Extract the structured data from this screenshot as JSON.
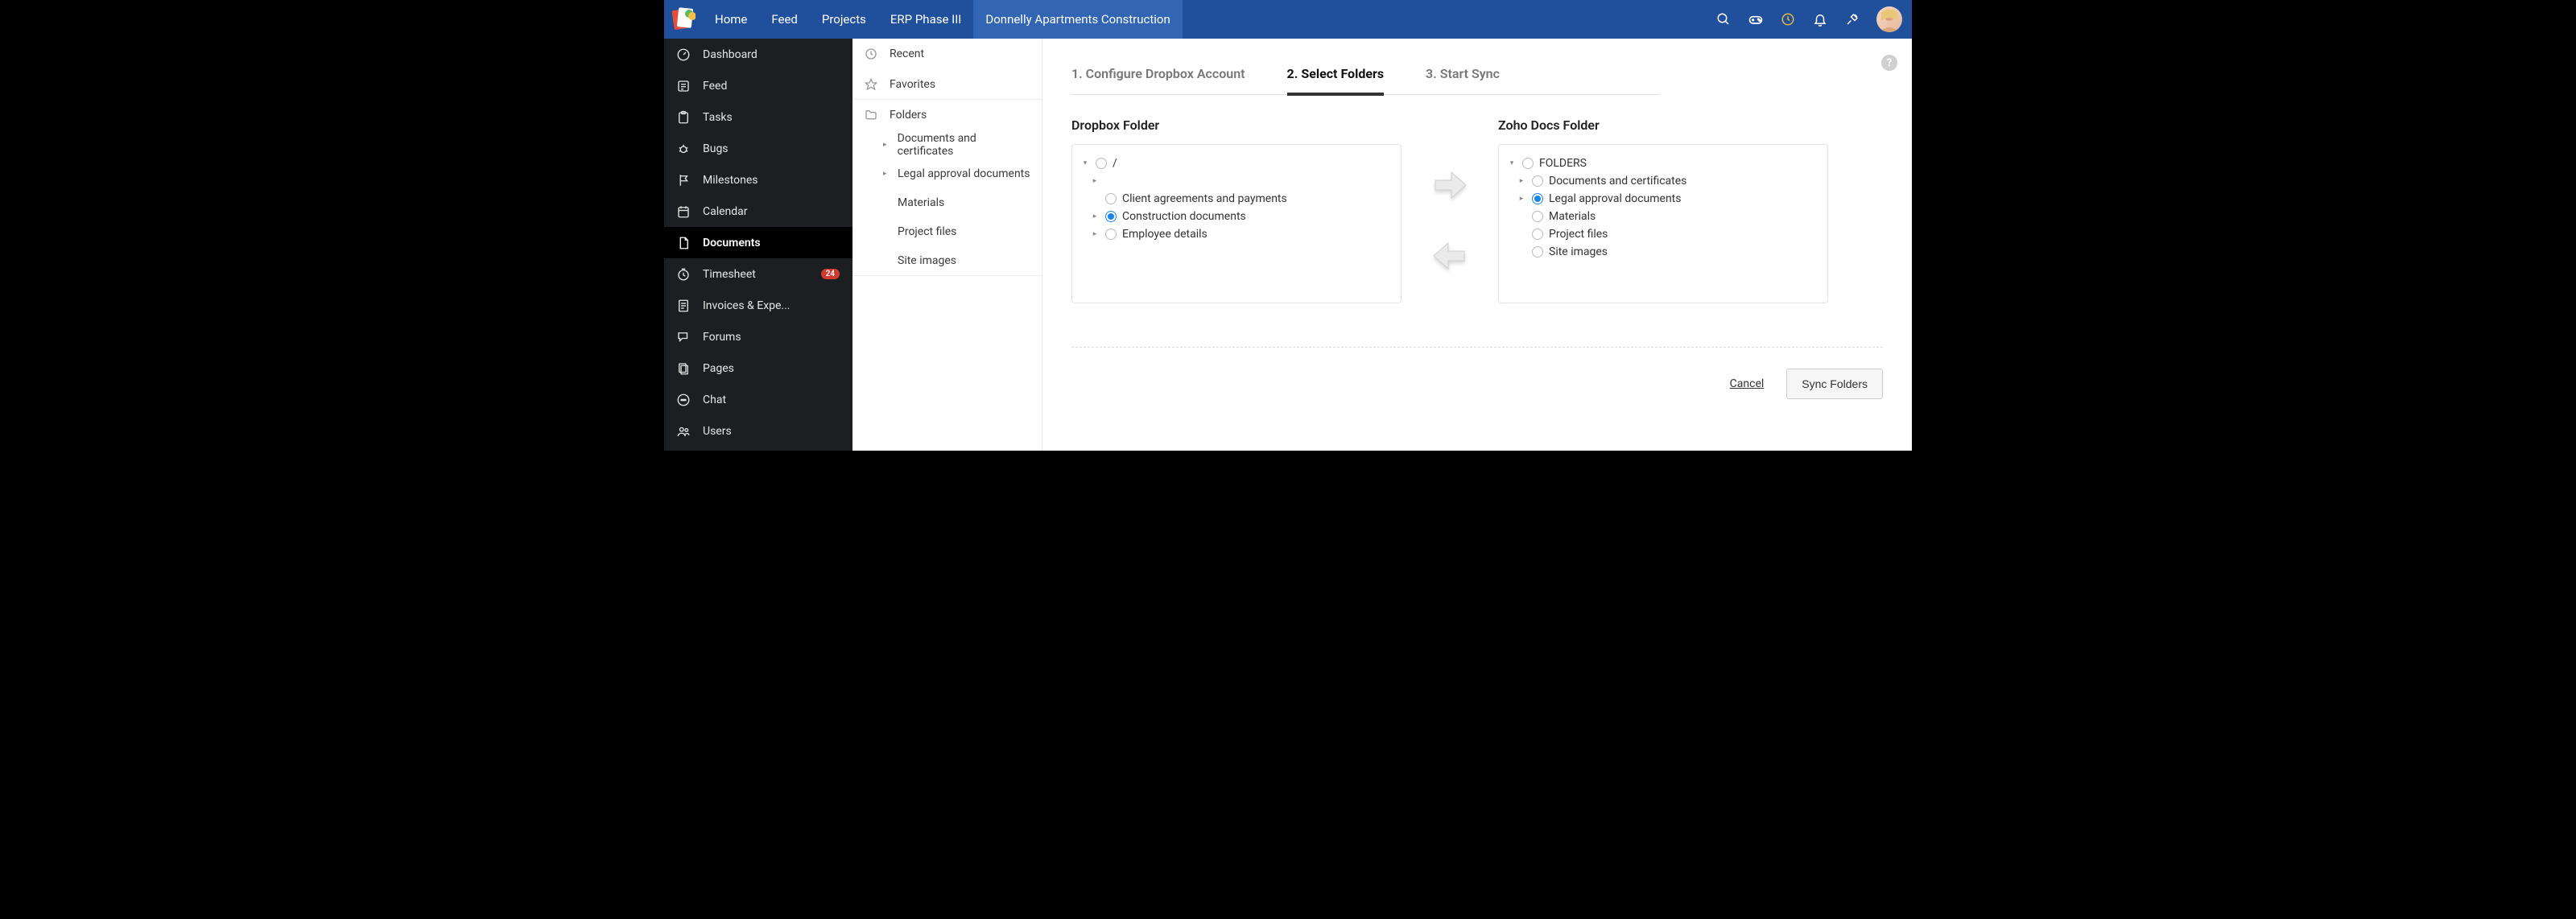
{
  "topnav": {
    "items": [
      {
        "label": "Home",
        "active": false
      },
      {
        "label": "Feed",
        "active": false
      },
      {
        "label": "Projects",
        "active": false
      },
      {
        "label": "ERP Phase III",
        "active": false
      },
      {
        "label": "Donnelly Apartments Construction",
        "active": true
      }
    ]
  },
  "sidebar": {
    "items": [
      {
        "icon": "dashboard",
        "label": "Dashboard"
      },
      {
        "icon": "feed",
        "label": "Feed"
      },
      {
        "icon": "tasks",
        "label": "Tasks"
      },
      {
        "icon": "bugs",
        "label": "Bugs"
      },
      {
        "icon": "milestones",
        "label": "Milestones"
      },
      {
        "icon": "calendar",
        "label": "Calendar"
      },
      {
        "icon": "documents",
        "label": "Documents",
        "active": true
      },
      {
        "icon": "timesheet",
        "label": "Timesheet",
        "badge": "24"
      },
      {
        "icon": "invoices",
        "label": "Invoices & Expe..."
      },
      {
        "icon": "forums",
        "label": "Forums"
      },
      {
        "icon": "pages",
        "label": "Pages"
      },
      {
        "icon": "chat",
        "label": "Chat"
      },
      {
        "icon": "users",
        "label": "Users"
      }
    ]
  },
  "subnav": {
    "recent": "Recent",
    "favorites": "Favorites",
    "folders_label": "Folders",
    "folders": [
      {
        "label": "Documents and certificates",
        "expandable": true
      },
      {
        "label": "Legal approval documents",
        "expandable": true
      },
      {
        "label": "Materials",
        "expandable": false
      },
      {
        "label": "Project files",
        "expandable": false
      },
      {
        "label": "Site images",
        "expandable": false
      }
    ]
  },
  "wizard": {
    "tabs": [
      {
        "label": "1. Configure Dropbox Account",
        "active": false
      },
      {
        "label": "2. Select Folders",
        "active": true
      },
      {
        "label": "3. Start Sync",
        "active": false
      }
    ],
    "left": {
      "title": "Dropbox Folder",
      "root": "/",
      "items": [
        {
          "label": "Client agreements and payments",
          "caret": "",
          "checked": false
        },
        {
          "label": "Construction documents",
          "caret": "▸",
          "checked": true
        },
        {
          "label": "Employee details",
          "caret": "▸",
          "checked": false
        }
      ]
    },
    "right": {
      "title": "Zoho Docs Folder",
      "root": "FOLDERS",
      "items": [
        {
          "label": "Documents and certificates",
          "caret": "▸",
          "checked": false
        },
        {
          "label": "Legal approval documents",
          "caret": "▸",
          "checked": true
        },
        {
          "label": "Materials",
          "caret": "",
          "checked": false
        },
        {
          "label": "Project files",
          "caret": "",
          "checked": false
        },
        {
          "label": "Site images",
          "caret": "",
          "checked": false
        }
      ]
    },
    "cancel": "Cancel",
    "sync": "Sync Folders"
  }
}
